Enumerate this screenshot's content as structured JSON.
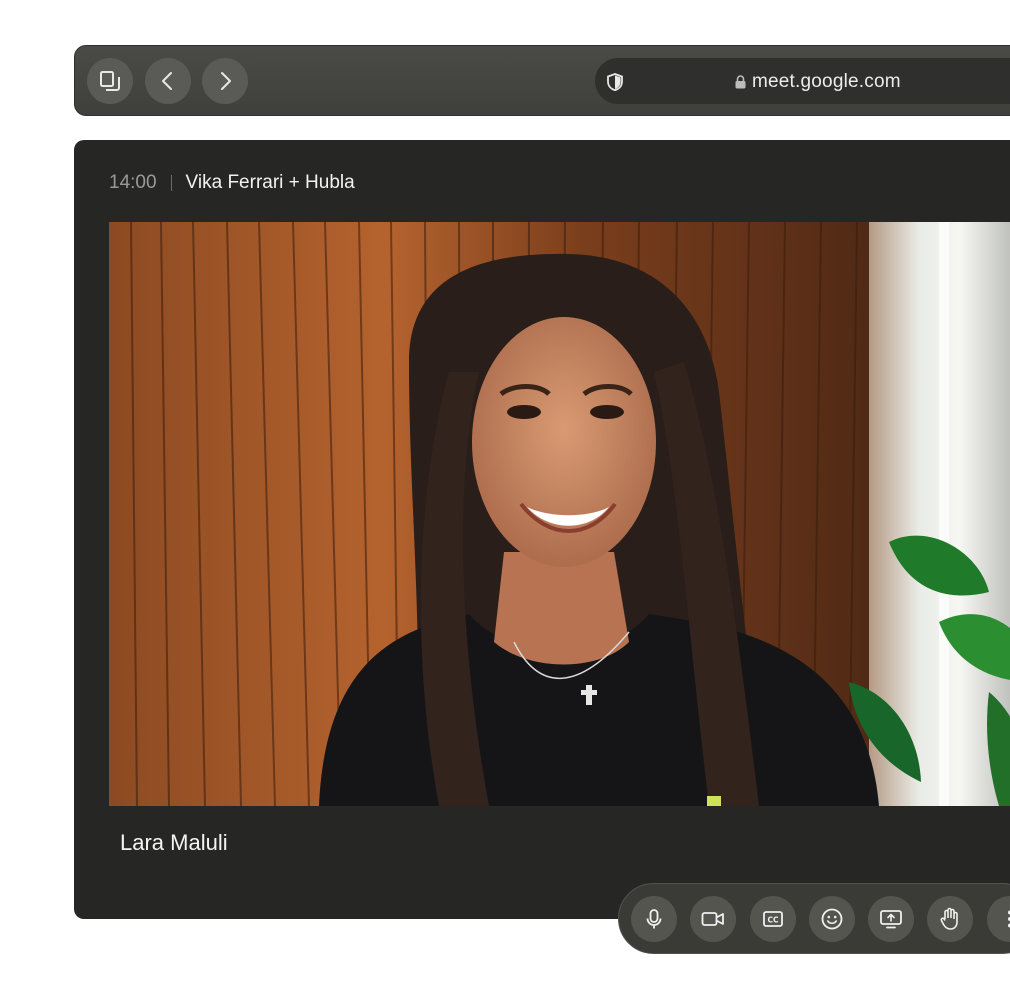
{
  "browser": {
    "url": "meet.google.com",
    "buttons": {
      "tabs": "tabs-icon",
      "back": "chevron-left-icon",
      "forward": "chevron-right-icon"
    },
    "icons": {
      "privacy": "shield-icon",
      "lock": "lock-icon"
    }
  },
  "meeting": {
    "time": "14:00",
    "title": "Vika Ferrari + Hubla",
    "participant": "Lara Maluli"
  },
  "controls": [
    {
      "icon": "microphone-icon"
    },
    {
      "icon": "camera-icon"
    },
    {
      "icon": "captions-icon"
    },
    {
      "icon": "emoji-icon"
    },
    {
      "icon": "present-screen-icon"
    },
    {
      "icon": "raise-hand-icon"
    },
    {
      "icon": "more-options-icon"
    }
  ],
  "colors": {
    "window_bg": "#262624",
    "toolbar_bg": "#4a4a47",
    "button_bg": "#5a5a57",
    "url_pill_bg": "#2f2f2d",
    "dock_bg": "#3a3a37"
  }
}
